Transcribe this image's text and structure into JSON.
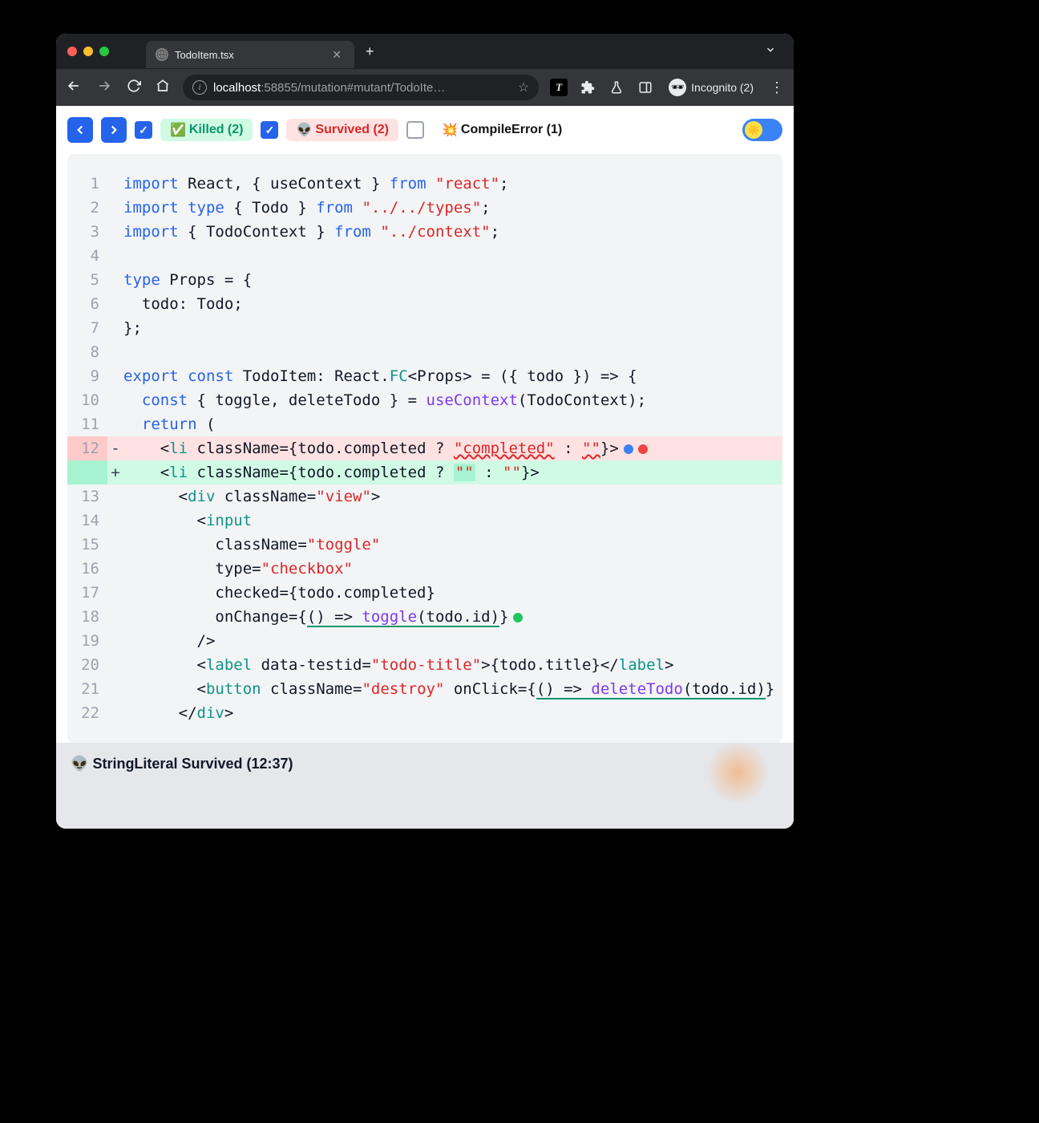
{
  "browser": {
    "tab_title": "TodoItem.tsx",
    "url_host": "localhost",
    "url_port": ":58855",
    "url_path": "/mutation#mutant/TodoIte…",
    "incognito_label": "Incognito (2)"
  },
  "toolbar": {
    "killed_label": "Killed (2)",
    "survived_label": "Survived (2)",
    "compile_label": "CompileError (1)"
  },
  "code": {
    "lines": [
      {
        "n": "1"
      },
      {
        "n": "2"
      },
      {
        "n": "3"
      },
      {
        "n": "4"
      },
      {
        "n": "5"
      },
      {
        "n": "6"
      },
      {
        "n": "7"
      },
      {
        "n": "8"
      },
      {
        "n": "9"
      },
      {
        "n": "10"
      },
      {
        "n": "11"
      },
      {
        "n": "12",
        "sign": "-"
      },
      {
        "n": "",
        "sign": "+"
      },
      {
        "n": "13"
      },
      {
        "n": "14"
      },
      {
        "n": "15"
      },
      {
        "n": "16"
      },
      {
        "n": "17"
      },
      {
        "n": "18"
      },
      {
        "n": "19"
      },
      {
        "n": "20"
      },
      {
        "n": "21"
      },
      {
        "n": "22"
      }
    ],
    "tokens": {
      "l1_kw1": "import",
      "l1_id": " React, { useContext } ",
      "l1_kw2": "from",
      "l1_str": " \"react\"",
      "l1_end": ";",
      "l2_kw1": "import",
      "l2_kw2": " type",
      "l2_id": " { Todo } ",
      "l2_kw3": "from",
      "l2_str": " \"../../types\"",
      "l2_end": ";",
      "l3_kw1": "import",
      "l3_id": " { TodoContext } ",
      "l3_kw2": "from",
      "l3_str": " \"../context\"",
      "l3_end": ";",
      "l5_kw": "type",
      "l5_id": " Props = {",
      "l6": "  todo: Todo;",
      "l7": "};",
      "l9_kw1": "export",
      "l9_kw2": " const",
      "l9_id1": " TodoItem: React.",
      "l9_ty": "FC",
      "l9_id2": "<Props> = ({ todo }) => {",
      "l10_pre": "  ",
      "l10_kw": "const",
      "l10_id1": " { toggle, deleteTodo } = ",
      "l10_fn": "useContext",
      "l10_id2": "(TodoContext);",
      "l11_pre": "  ",
      "l11_kw": "return",
      "l11_end": " (",
      "l12r_pre": "    <",
      "l12r_tag": "li",
      "l12r_mid": " className={todo.completed ? ",
      "l12r_str1": "\"completed\"",
      "l12r_colon": " : ",
      "l12r_str2": "\"\"",
      "l12r_end": "}>",
      "l12a_pre": "    <",
      "l12a_tag": "li",
      "l12a_mid": " className={todo.completed ? ",
      "l12a_str1": "\"\"",
      "l12a_colon": " : ",
      "l12a_str2": "\"\"",
      "l12a_end": "}>",
      "l13_pre": "      <",
      "l13_tag": "div",
      "l13_mid": " className=",
      "l13_str": "\"view\"",
      "l13_end": ">",
      "l14_pre": "        <",
      "l14_tag": "input",
      "l15_pre": "          className=",
      "l15_str": "\"toggle\"",
      "l16_pre": "          type=",
      "l16_str": "\"checkbox\"",
      "l17": "          checked={todo.completed}",
      "l18_pre": "          onChange={",
      "l18_arrow": "() => ",
      "l18_fn": "toggle",
      "l18_arg": "(todo.id)",
      "l18_end": "}",
      "l19": "        />",
      "l20_pre": "        <",
      "l20_tag": "label",
      "l20_mid": " data-testid=",
      "l20_str": "\"todo-title\"",
      "l20_txt": ">{todo.title}</",
      "l20_tag2": "label",
      "l20_end": ">",
      "l21_pre": "        <",
      "l21_tag": "button",
      "l21_mid": " className=",
      "l21_str": "\"destroy\"",
      "l21_oc": " onClick={",
      "l21_arrow": "() => ",
      "l21_fn": "deleteTodo",
      "l21_arg": "(todo.id)",
      "l21_end": "} /",
      "l22_pre": "      </",
      "l22_tag": "div",
      "l22_end": ">"
    }
  },
  "status": {
    "icon": "👽",
    "text": "StringLiteral Survived (12:37)"
  }
}
